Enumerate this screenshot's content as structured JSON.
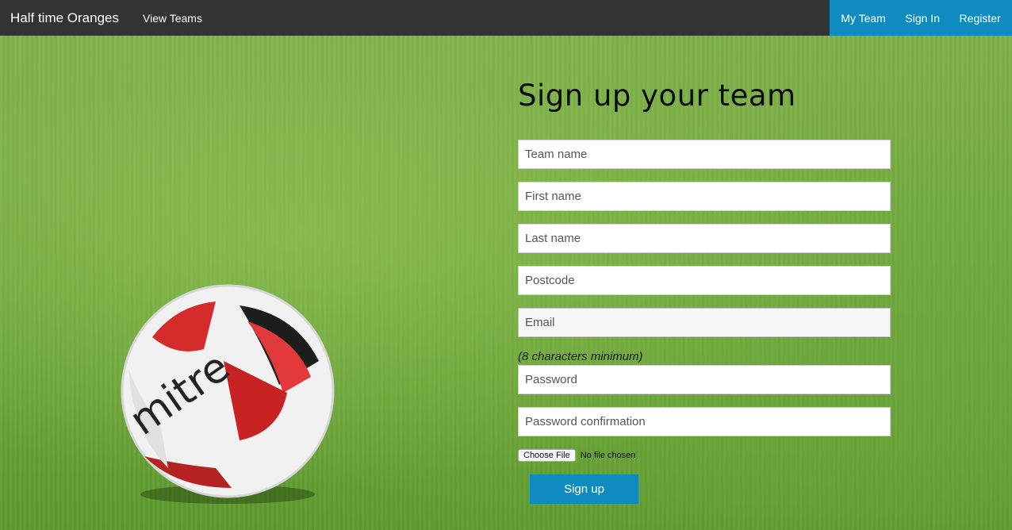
{
  "nav": {
    "brand": "Half time Oranges",
    "view_teams": "View Teams",
    "my_team": "My Team",
    "sign_in": "Sign In",
    "register": "Register"
  },
  "form": {
    "title": "Sign up your team",
    "team_name_placeholder": "Team name",
    "first_name_placeholder": "First name",
    "last_name_placeholder": "Last name",
    "postcode_placeholder": "Postcode",
    "email_placeholder": "Email",
    "password_hint": "(8 characters minimum)",
    "password_placeholder": "Password",
    "password_confirmation_placeholder": "Password confirmation",
    "file_button": "Choose File",
    "file_status": "No file chosen",
    "submit_label": "Sign up"
  },
  "colors": {
    "navbar": "#333333",
    "accent": "#0f8bbf"
  }
}
